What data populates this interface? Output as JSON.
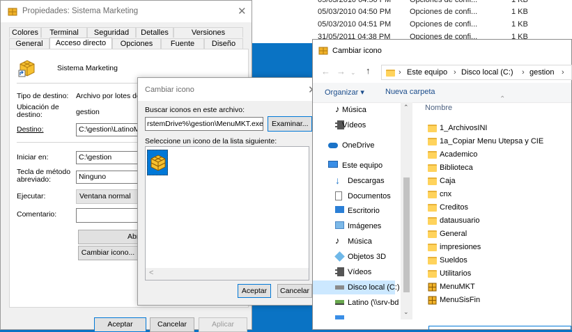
{
  "background_list": {
    "rows": [
      {
        "date": "05/03/2010 04:50 PM",
        "type": "Opciones de confi...",
        "size": "1 KB"
      },
      {
        "date": "05/03/2010 04:50 PM",
        "type": "Opciones de confi...",
        "size": "1 KB"
      },
      {
        "date": "05/03/2010 04:51 PM",
        "type": "Opciones de confi...",
        "size": "1 KB"
      },
      {
        "date": "31/05/2011 04:38 PM",
        "type": "Opciones de confi...",
        "size": "1 KB"
      }
    ]
  },
  "properties": {
    "title": "Propiedades: Sistema Marketing",
    "tabs_row1": [
      "Colores",
      "Terminal",
      "Seguridad",
      "Detalles",
      "Versiones anteriores"
    ],
    "tabs_row2": [
      "General",
      "Acceso directo",
      "Opciones",
      "Fuente",
      "Diseño"
    ],
    "active_tab": "Acceso directo",
    "shortcut_name": "Sistema Marketing",
    "labels": {
      "tipo_destino": "Tipo de destino:",
      "ubicacion_destino": "Ubicación de destino:",
      "destino": "Destino:",
      "iniciar_en": "Iniciar en:",
      "tecla_metodo": "Tecla de método abreviado:",
      "ejecutar": "Ejecutar:",
      "comentario": "Comentario:"
    },
    "values": {
      "tipo_destino": "Archivo por lotes de Windows",
      "ubicacion_destino": "gestion",
      "destino": "C:\\gestion\\LatinoMKT.bat",
      "iniciar_en": "C:\\gestion",
      "tecla_metodo": "Ninguno",
      "ejecutar": "Ventana normal",
      "comentario": ""
    },
    "buttons": {
      "abrir_ubicacion": "Abrir ubicación",
      "cambiar_icono": "Cambiar icono...",
      "aceptar": "Aceptar",
      "cancelar": "Cancelar",
      "aplicar": "Aplicar"
    }
  },
  "change_icon": {
    "title": "Cambiar icono",
    "search_label": "Buscar iconos en este archivo:",
    "file_path": "rstemDrive%\\gestion\\MenuMKT.exe",
    "browse_button": "Examinar...",
    "select_label": "Seleccione un icono de la lista siguiente:",
    "aceptar": "Aceptar",
    "cancelar": "Cancelar"
  },
  "picker": {
    "title": "Cambiar icono",
    "breadcrumb": [
      "Este equipo",
      "Disco local (C:)",
      "gestion"
    ],
    "organize": "Organizar",
    "new_folder": "Nueva carpeta",
    "column_header": "Nombre",
    "nav_items": [
      {
        "label": "Música",
        "icon": "music-icon"
      },
      {
        "label": "Vídeos",
        "icon": "video-icon"
      },
      {
        "label": "OneDrive",
        "icon": "cloud-icon"
      },
      {
        "label": "Este equipo",
        "icon": "computer-icon"
      },
      {
        "label": "Descargas",
        "icon": "download-icon"
      },
      {
        "label": "Documentos",
        "icon": "document-icon"
      },
      {
        "label": "Escritorio",
        "icon": "desktop-icon"
      },
      {
        "label": "Imágenes",
        "icon": "image-icon"
      },
      {
        "label": "Música",
        "icon": "music-icon"
      },
      {
        "label": "Objetos 3D",
        "icon": "cube-icon"
      },
      {
        "label": "Vídeos",
        "icon": "video-icon"
      },
      {
        "label": "Disco local (C:)",
        "icon": "drive-icon"
      },
      {
        "label": "Latino (\\\\srv-bd",
        "icon": "network-drive-icon"
      }
    ],
    "files": [
      {
        "name": "1_ArchivosINI",
        "kind": "folder"
      },
      {
        "name": "1a_Copiar Menu Utepsa y CIE",
        "kind": "folder"
      },
      {
        "name": "Academico",
        "kind": "folder"
      },
      {
        "name": "Biblioteca",
        "kind": "folder"
      },
      {
        "name": "Caja",
        "kind": "folder"
      },
      {
        "name": "cnx",
        "kind": "folder"
      },
      {
        "name": "Creditos",
        "kind": "folder"
      },
      {
        "name": "datausuario",
        "kind": "folder"
      },
      {
        "name": "General",
        "kind": "folder"
      },
      {
        "name": "impresiones",
        "kind": "folder"
      },
      {
        "name": "Sueldos",
        "kind": "folder"
      },
      {
        "name": "Utilitarios",
        "kind": "folder"
      },
      {
        "name": "MenuMKT",
        "kind": "app"
      },
      {
        "name": "MenuSisFin",
        "kind": "app"
      }
    ],
    "colors": {
      "selected_nav": "#cce8ff",
      "folder": "#ffd35c",
      "accent": "#0078d7"
    }
  }
}
